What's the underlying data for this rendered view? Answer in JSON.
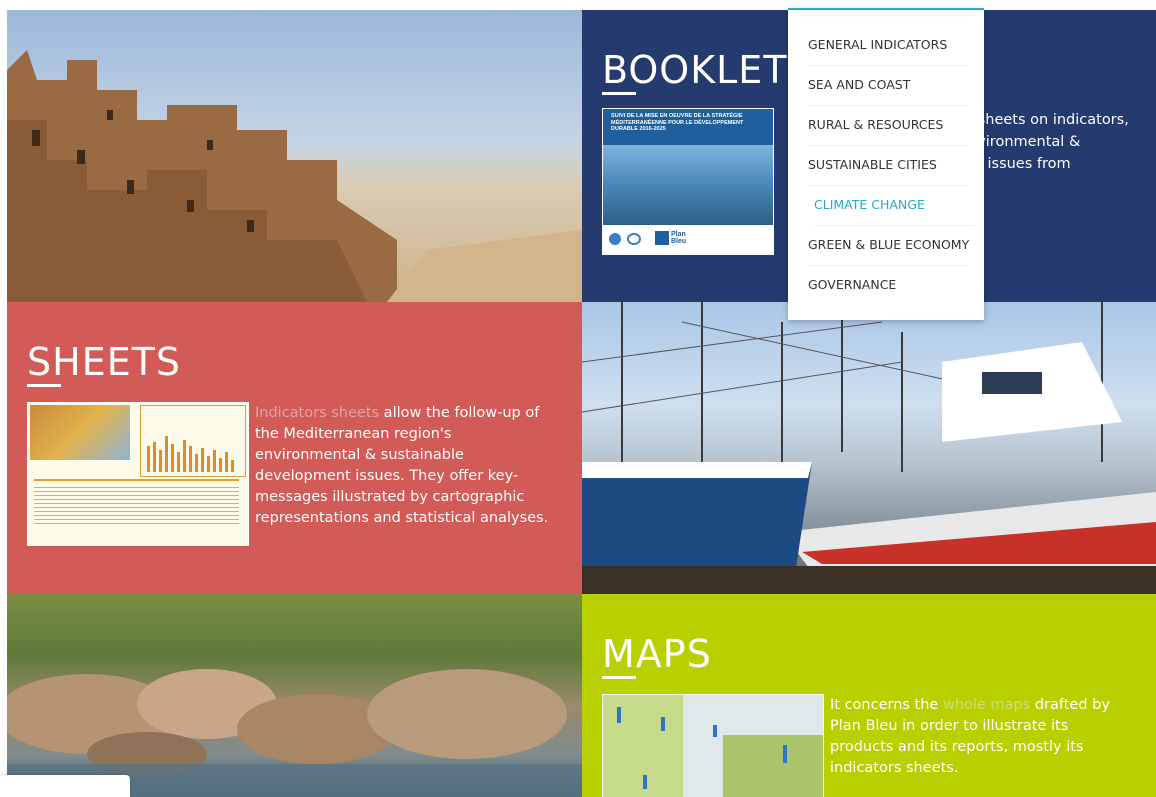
{
  "tiles": {
    "booklets": {
      "title": "BOOKLETS",
      "text_partial": [
        "f sheets on indicators,",
        "nvironmental &",
        "nt issues from"
      ],
      "thumb_title": "SUIVI DE LA MISE EN OEUVRE DE LA STRATÉGIE MÉDITERRANÉENNE POUR LE DÉVELOPPEMENT DURABLE 2016-2025",
      "thumb_logo": "Plan Bleu"
    },
    "sheets": {
      "title": "SHEETS",
      "link": "Indicators sheets",
      "text": " allow the  follow-up of the Mediterranean region's environmental & sustainable development issues. They offer key-messages illustrated by cartographic representations and statistical analyses."
    },
    "maps": {
      "title": "MAPS",
      "text_before": "It concerns the ",
      "link": "whole maps",
      "text_after": " drafted by Plan Bleu in order to illustrate its products and its reports, mostly its indicators sheets."
    }
  },
  "menu": {
    "items": [
      {
        "label": "GENERAL INDICATORS"
      },
      {
        "label": "SEA AND COAST"
      },
      {
        "label": "RURAL & RESOURCES"
      },
      {
        "label": "SUSTAINABLE CITIES"
      },
      {
        "label": "CLIMATE CHANGE"
      },
      {
        "label": "GREEN & BLUE ECONOMY"
      },
      {
        "label": "GOVERNANCE"
      }
    ],
    "active_index": 4
  },
  "colors": {
    "booklets_bg": "#253a6e",
    "sheets_bg": "#d25a57",
    "maps_bg": "#b8cf00",
    "menu_active": "#2aa8c8"
  },
  "images": {
    "photo1": "kasbah-photo",
    "photo2": "fishing-boats-photo",
    "photo3": "river-rocks-photo"
  }
}
